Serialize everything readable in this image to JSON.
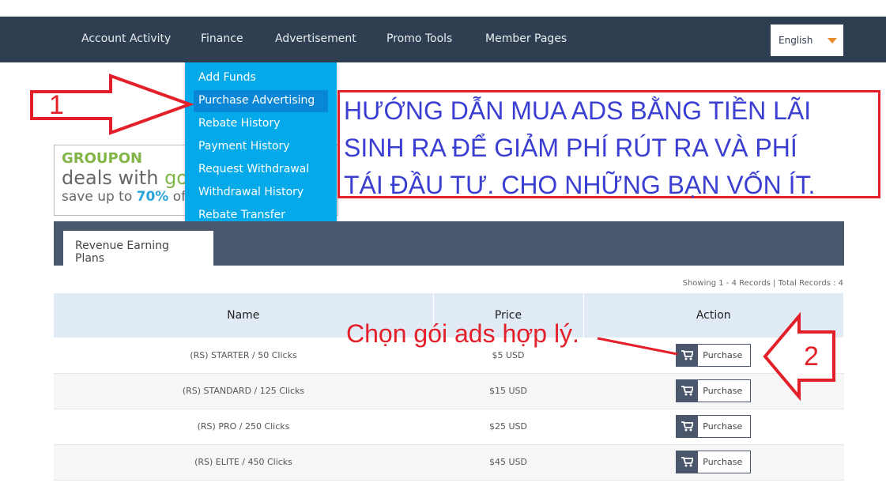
{
  "nav": {
    "items": [
      "Account Activity",
      "Finance",
      "Advertisement",
      "Promo Tools",
      "Member Pages"
    ],
    "language": "English"
  },
  "finance_menu": {
    "items": [
      "Add Funds",
      "Purchase Advertising",
      "Rebate History",
      "Payment History",
      "Request Withdrawal",
      "Withdrawal History",
      "Rebate Transfer"
    ],
    "active": "Purchase Advertising"
  },
  "ad": {
    "brand": "GROUPON",
    "line1a": "deals with ",
    "line1b": "goo",
    "line2a": "save up to ",
    "line2b": "70%",
    "line2c": " off*"
  },
  "tab": {
    "label": "Revenue Earning Plans"
  },
  "records": "Showing 1 - 4 Records | Total Records : 4",
  "table": {
    "headers": [
      "Name",
      "Price",
      "Action"
    ],
    "rows": [
      {
        "name": "(RS) STARTER / 50 Clicks",
        "price": "$5 USD",
        "action": "Purchase"
      },
      {
        "name": "(RS) STANDARD / 125 Clicks",
        "price": "$15 USD",
        "action": "Purchase"
      },
      {
        "name": "(RS) PRO / 250 Clicks",
        "price": "$25 USD",
        "action": "Purchase"
      },
      {
        "name": "(RS) ELITE / 450 Clicks",
        "price": "$45 USD",
        "action": "Purchase"
      }
    ]
  },
  "annotations": {
    "step1": "1",
    "step2": "2",
    "instruction": [
      "HƯỚNG DẪN MUA ADS BẰNG TIỀN LÃI",
      "SINH RA ĐỂ GIẢM PHÍ RÚT RA VÀ PHÍ",
      "TÁI ĐẦU TƯ. CHO NHỮNG BẠN VỐN ÍT."
    ],
    "choose": "Chọn gói ads hợp lý."
  },
  "colors": {
    "nav": "#2f3e50",
    "menu": "#03a9e8",
    "annotation_red": "#e3202a",
    "annotation_blue": "#3a3fd1"
  }
}
